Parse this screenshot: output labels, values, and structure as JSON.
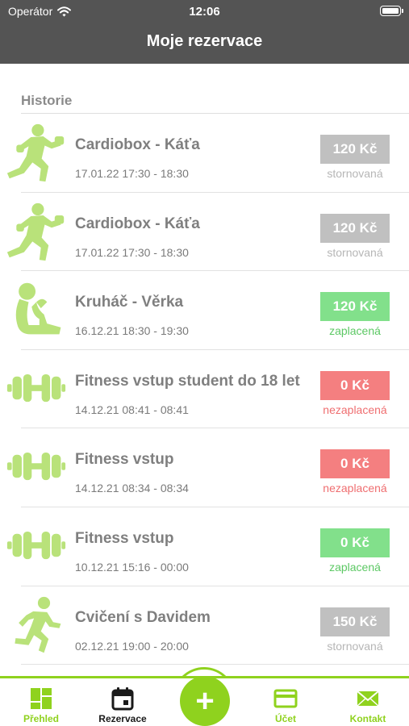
{
  "status_bar": {
    "carrier": "Operátor",
    "time": "12:06"
  },
  "nav": {
    "title": "Moje rezervace"
  },
  "section": {
    "title": "Historie"
  },
  "reservations": [
    {
      "title": "Cardiobox - Káťa",
      "time": "17.01.22 17:30 - 18:30",
      "price": "120 Kč",
      "status": "stornovaná",
      "icon": "boxing-icon"
    },
    {
      "title": "Cardiobox - Káťa",
      "time": "17.01.22 17:30 - 18:30",
      "price": "120 Kč",
      "status": "stornovaná",
      "icon": "boxing-icon"
    },
    {
      "title": "Kruháč - Věrka",
      "time": "16.12.21 18:30 - 19:30",
      "price": "120 Kč",
      "status": "zaplacená",
      "icon": "situp-icon"
    },
    {
      "title": "Fitness vstup student do 18 let",
      "time": "14.12.21 08:41 - 08:41",
      "price": "0 Kč",
      "status": "nezaplacená",
      "icon": "dumbbell-icon"
    },
    {
      "title": "Fitness vstup",
      "time": "14.12.21 08:34 - 08:34",
      "price": "0 Kč",
      "status": "nezaplacená",
      "icon": "dumbbell-icon"
    },
    {
      "title": "Fitness vstup",
      "time": "10.12.21 15:16 - 00:00",
      "price": "0 Kč",
      "status": "zaplacená",
      "icon": "dumbbell-icon"
    },
    {
      "title": "Cvičení s Davidem",
      "time": "02.12.21 19:00 - 20:00",
      "price": "150 Kč",
      "status": "stornovaná",
      "icon": "running-icon"
    }
  ],
  "tabbar": {
    "overview": "Přehled",
    "reservations": "Rezervace",
    "add": "+",
    "account": "Účet",
    "contact": "Kontakt"
  },
  "colors": {
    "header": "#545454",
    "accent": "#8fd21e",
    "icon": "#b9e27a",
    "paid": "#82e08b",
    "unpaid": "#f47f80",
    "cancelled": "#c0c0c0"
  }
}
